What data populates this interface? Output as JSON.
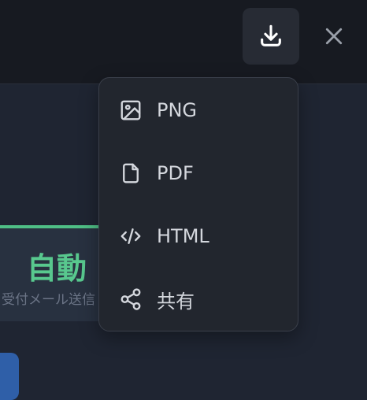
{
  "header": {
    "download_icon": "download-icon",
    "close_icon": "close-icon"
  },
  "card": {
    "value": "自動",
    "subtitle": "受付メール送信"
  },
  "export_menu": {
    "items": [
      {
        "label": "PNG",
        "icon": "image-icon"
      },
      {
        "label": "PDF",
        "icon": "file-icon"
      },
      {
        "label": "HTML",
        "icon": "code-icon"
      },
      {
        "label": "共有",
        "icon": "share-icon"
      }
    ]
  },
  "colors": {
    "accent_green": "#58c88e",
    "menu_bg": "#22262e",
    "text": "#d4d7dd"
  }
}
